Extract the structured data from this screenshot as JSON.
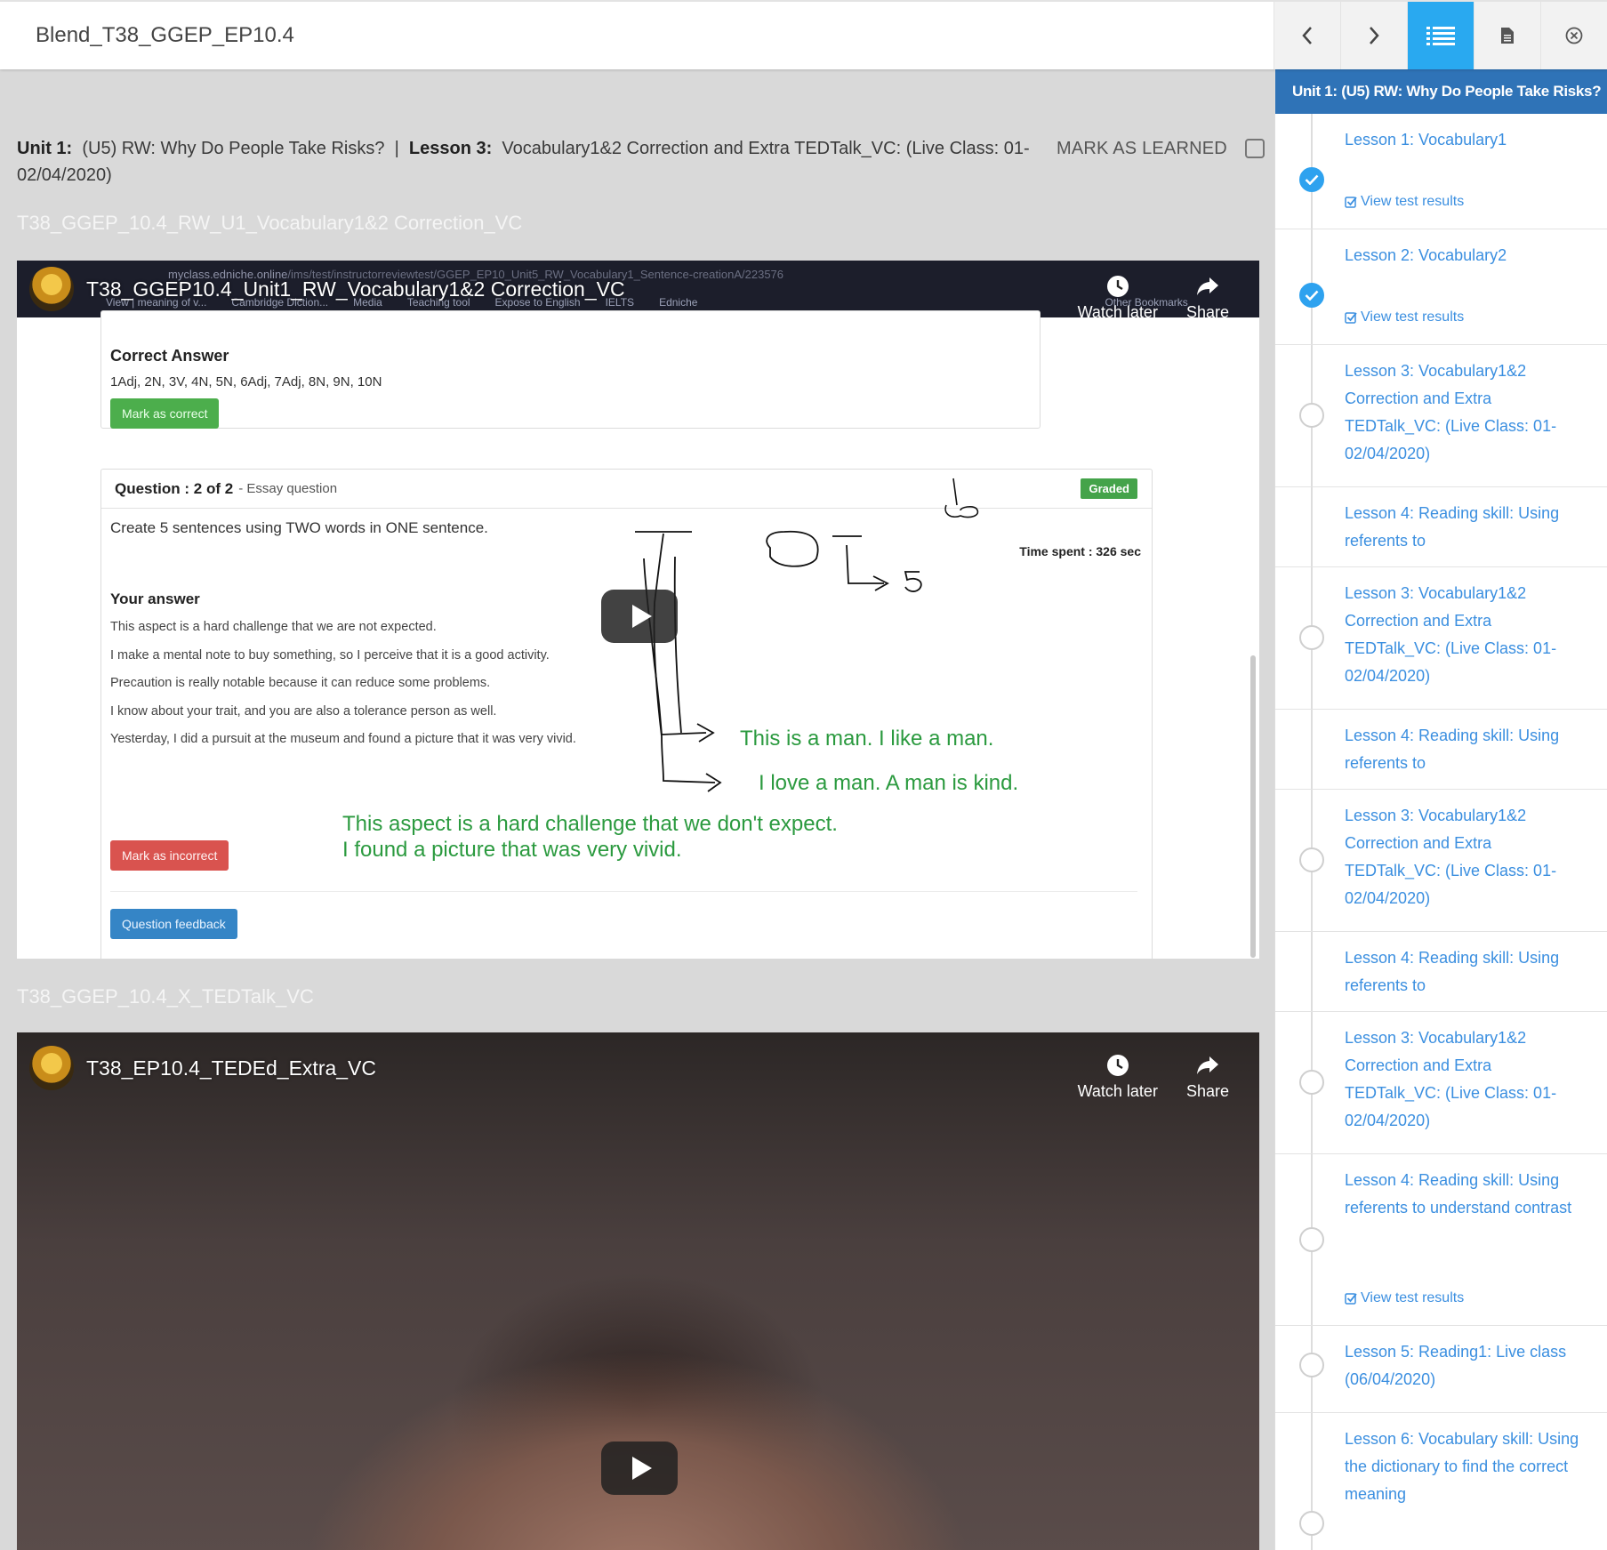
{
  "topbar": {
    "course_title": "Blend_T38_GGEP_EP10.4",
    "buttons": [
      {
        "name": "prev",
        "icon": "chevron-left-icon"
      },
      {
        "name": "next",
        "icon": "chevron-right-icon"
      },
      {
        "name": "lesson-list",
        "icon": "list-icon",
        "active": true
      },
      {
        "name": "notes",
        "icon": "document-icon"
      },
      {
        "name": "close",
        "icon": "close-circle-icon"
      }
    ]
  },
  "main": {
    "breadcrumb": {
      "unit_label": "Unit 1:",
      "unit_title": "(U5) RW: Why Do People Take Risks?",
      "separator": "|",
      "lesson_label": "Lesson 3:",
      "lesson_title": "Vocabulary1&2 Correction and Extra TEDTalk_VC: (Live Class: 01-02/04/2020)"
    },
    "mark_as_learned": "MARK AS LEARNED",
    "sections": [
      {
        "title": "T38_GGEP_10.4_RW_U1_Vocabulary1&2 Correction_VC"
      },
      {
        "title": "T38_GGEP_10.4_X_TEDTalk_VC"
      }
    ]
  },
  "video1": {
    "title": "T38_GGEP10.4_Unit1_RW_Vocabulary1&2 Correction_VC",
    "watch_later": "Watch later",
    "share": "Share",
    "browser_url_host": "myclass.edniche.online",
    "browser_url_path": "/ims/test/instructorreviewtest/GGEP_EP10_Unit5_RW_Vocabulary1_Sentence-creationA/223576",
    "bookmarks": [
      "View | meaning of v...",
      "Cambridge Diction...",
      "Media",
      "Teaching tool",
      "Expose to English",
      "IELTS",
      "Edniche",
      "Other Bookmarks"
    ],
    "correct_answer_title": "Correct Answer",
    "correct_answer_values": "1Adj, 2N, 3V, 4N, 5N, 6Adj, 7Adj, 8N, 9N, 10N",
    "mark_correct": "Mark as correct",
    "question_label": "Question : 2 of 2",
    "question_type": "- Essay question",
    "graded": "Graded",
    "prompt": "Create 5 sentences using TWO words in ONE sentence.",
    "time_spent": "Time spent : 326 sec",
    "your_answer": "Your answer",
    "answers": [
      "This aspect is a hard challenge that we are not expected.",
      "I make a mental note to buy something, so I perceive that it is a good activity.",
      "Precaution is really notable because it can reduce some problems.",
      "I know about your trait, and you are also a tolerance person as well.",
      "Yesterday, I did a pursuit at the museum and found a picture that it was very vivid."
    ],
    "handwritten": {
      "line1": "This is a man. I like a man.",
      "line2": "I love a man. A man is kind.",
      "line3": "This aspect is a hard challenge that we don't expect.",
      "line4": "I found a picture that was very vivid."
    },
    "mark_incorrect": "Mark as incorrect",
    "question_feedback": "Question feedback"
  },
  "video2": {
    "title": "T38_EP10.4_TEDEd_Extra_VC",
    "watch_later": "Watch later",
    "share": "Share"
  },
  "sidebar": {
    "header": "Unit 1:  (U5) RW: Why Do People Take Risks?",
    "view_results_label": "View test results",
    "items": [
      {
        "label": "Lesson 1: Vocabulary1",
        "done": true,
        "results": true
      },
      {
        "label": "Lesson 2: Vocabulary2",
        "done": true,
        "results": true
      },
      {
        "label": "Lesson 3: Vocabulary1&2 Correction and Extra TEDTalk_VC: (Live Class: 01-02/04/2020)",
        "done": false,
        "results": false
      },
      {
        "label": "Lesson 4: Reading skill: Using referents to",
        "done": false,
        "results": false
      },
      {
        "label": "Lesson 3: Vocabulary1&2 Correction and Extra TEDTalk_VC: (Live Class: 01-02/04/2020)",
        "done": false,
        "results": false
      },
      {
        "label": "Lesson 4: Reading skill: Using referents to",
        "done": false,
        "results": false
      },
      {
        "label": "Lesson 3: Vocabulary1&2 Correction and Extra TEDTalk_VC: (Live Class: 01-02/04/2020)",
        "done": false,
        "results": false
      },
      {
        "label": "Lesson 4: Reading skill: Using referents to",
        "done": false,
        "results": false
      },
      {
        "label": "Lesson 3: Vocabulary1&2 Correction and Extra TEDTalk_VC: (Live Class: 01-02/04/2020)",
        "done": false,
        "results": false
      },
      {
        "label": "Lesson 4: Reading skill: Using referents to understand contrast",
        "done": false,
        "results": true
      },
      {
        "label": "Lesson 5: Reading1: Live class (06/04/2020)",
        "done": false,
        "results": false
      },
      {
        "label": "Lesson 6: Vocabulary skill: Using the dictionary to find the correct meaning",
        "done": false,
        "results": false
      }
    ]
  },
  "colors": {
    "accent": "#29a9f0",
    "sidebar_header": "#2f73b7",
    "link": "#3b8fe0",
    "graded_green": "#44a34a"
  }
}
